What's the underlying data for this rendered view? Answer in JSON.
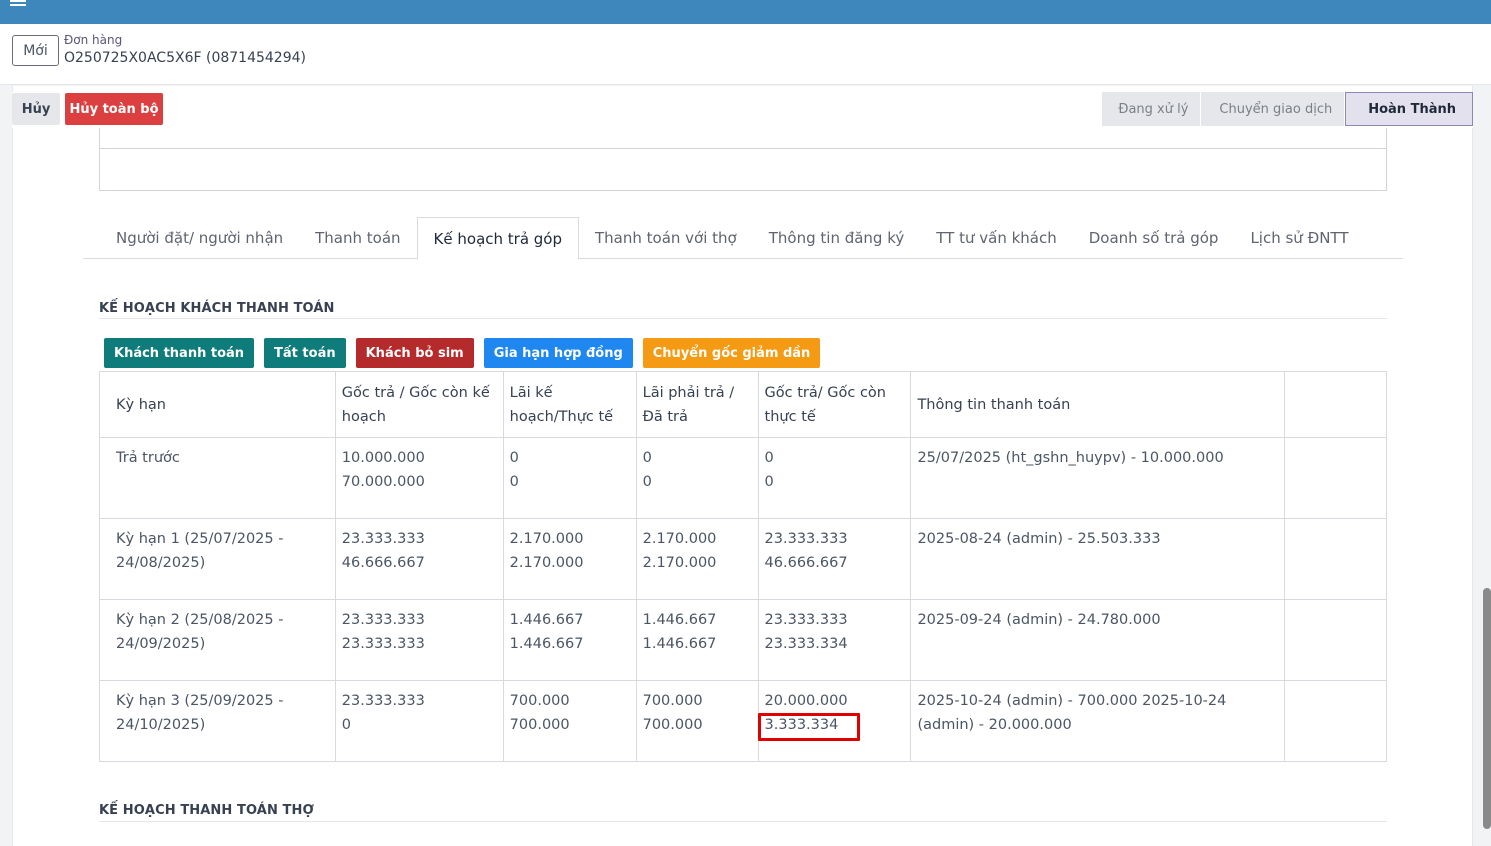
{
  "header": {
    "new_label": "Mới",
    "breadcrumb_parent": "Đơn hàng",
    "breadcrumb_current": "O250725X0AC5X6F (0871454294)"
  },
  "statusbar": {
    "cancel_label": "Hủy",
    "cancel_all_label": "Hủy toàn bộ",
    "stages": [
      "Đang xử lý",
      "Chuyển giao dịch",
      "Hoàn Thành"
    ],
    "active_stage": "Hoàn Thành"
  },
  "tabs": [
    "Người đặt/ người nhận",
    "Thanh toán",
    "Kế hoạch trả góp",
    "Thanh toán với thợ",
    "Thông tin đăng ký",
    "TT tư vấn khách",
    "Doanh số trả góp",
    "Lịch sử ĐNTT"
  ],
  "active_tab": "Kế hoạch trả góp",
  "section1_title": "KẾ HOẠCH KHÁCH THANH TOÁN",
  "section2_title": "KẾ HOẠCH THANH TOÁN THỢ",
  "actions": [
    {
      "label": "Khách thanh toán",
      "color": "#0f7c7c"
    },
    {
      "label": "Tất toán",
      "color": "#0f7c7c"
    },
    {
      "label": "Khách bỏ sim",
      "color": "#b52a2a"
    },
    {
      "label": "Gia hạn hợp đồng",
      "color": "#1e88f0"
    },
    {
      "label": "Chuyển gốc giảm dần",
      "color": "#f59b13"
    }
  ],
  "table": {
    "headers": [
      "Kỳ hạn",
      "Gốc trả / Gốc còn kế hoạch",
      "Lãi kế hoạch/Thực tế",
      "Lãi phải trả / Đã trả",
      "Gốc trả/ Gốc còn thực tế",
      "Thông tin thanh toán",
      ""
    ],
    "rows": [
      {
        "term": "Trả trước",
        "goc_kh": [
          "10.000.000",
          "70.000.000"
        ],
        "lai_kh": [
          "0",
          "0"
        ],
        "lai_tra": [
          "0",
          "0"
        ],
        "goc_tt": [
          "0",
          "0"
        ],
        "info": "25/07/2025 (ht_gshn_huypv) - 10.000.000"
      },
      {
        "term": "Kỳ hạn 1 (25/07/2025 - 24/08/2025)",
        "goc_kh": [
          "23.333.333",
          "46.666.667"
        ],
        "lai_kh": [
          "2.170.000",
          "2.170.000"
        ],
        "lai_tra": [
          "2.170.000",
          "2.170.000"
        ],
        "goc_tt": [
          "23.333.333",
          "46.666.667"
        ],
        "info": "2025-08-24 (admin) - 25.503.333"
      },
      {
        "term": "Kỳ hạn 2 (25/08/2025 - 24/09/2025)",
        "goc_kh": [
          "23.333.333",
          "23.333.333"
        ],
        "lai_kh": [
          "1.446.667",
          "1.446.667"
        ],
        "lai_tra": [
          "1.446.667",
          "1.446.667"
        ],
        "goc_tt": [
          "23.333.333",
          "23.333.334"
        ],
        "info": "2025-09-24 (admin) - 24.780.000"
      },
      {
        "term": "Kỳ hạn 3 (25/09/2025 - 24/10/2025)",
        "goc_kh": [
          "23.333.333",
          "0"
        ],
        "lai_kh": [
          "700.000",
          "700.000"
        ],
        "lai_tra": [
          "700.000",
          "700.000"
        ],
        "goc_tt": [
          "20.000.000",
          "3.333.334"
        ],
        "info": "2025-10-24 (admin) - 700.000 2025-10-24 (admin) - 20.000.000"
      }
    ]
  }
}
